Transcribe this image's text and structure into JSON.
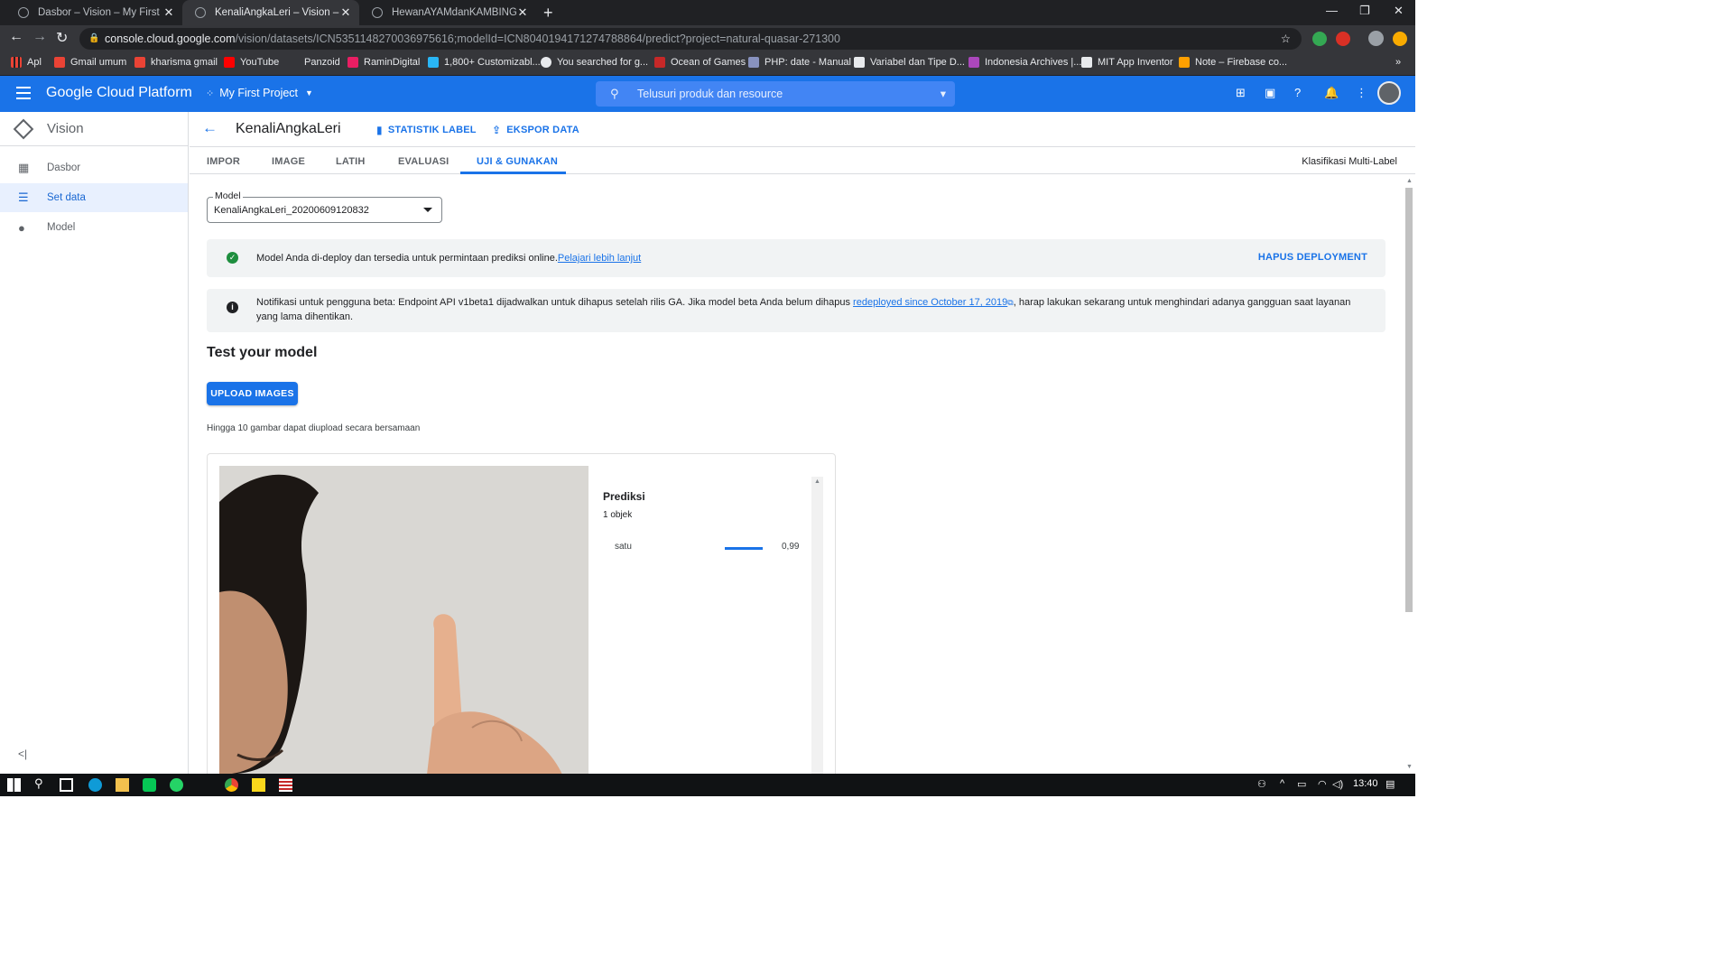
{
  "browser": {
    "tabs": [
      {
        "title": "Dasbor – Vision – My First Projec",
        "active": false
      },
      {
        "title": "KenaliAngkaLeri – Vision – My Fir",
        "active": true
      },
      {
        "title": "HewanAYAMdanKAMBING – Visi",
        "active": false
      }
    ],
    "url_host": "console.cloud.google.com",
    "url_path": "/vision/datasets/ICN5351148270036975616;modelId=ICN8040194171274788864/predict?project=natural-quasar-271300",
    "bookmarks": [
      "Apl",
      "Gmail umum",
      "kharisma gmail",
      "YouTube",
      "Panzoid",
      "RaminDigital",
      "1,800+ Customizabl...",
      "You searched for g...",
      "Ocean of Games",
      "PHP: date - Manual",
      "Variabel dan Tipe D...",
      "Indonesia Archives |...",
      "MIT App Inventor",
      "Note – Firebase co..."
    ]
  },
  "header": {
    "title": "Google Cloud Platform",
    "project": "My First Project",
    "search_placeholder": "Telusuri produk dan resource"
  },
  "sidenav": {
    "product": "Vision",
    "items": [
      {
        "label": "Dasbor",
        "icon": "dashboard-icon",
        "active": false
      },
      {
        "label": "Set data",
        "icon": "list-icon",
        "active": true
      },
      {
        "label": "Model",
        "icon": "lightbulb-icon",
        "active": false
      }
    ]
  },
  "main": {
    "dataset_title": "KenaliAngkaLeri",
    "actions": [
      "STATISTIK LABEL",
      "EKSPOR DATA"
    ],
    "tabs": [
      "IMPOR",
      "IMAGE",
      "LATIH",
      "EVALUASI",
      "UJI & GUNAKAN"
    ],
    "active_tab": "UJI & GUNAKAN",
    "mode": "Klasifikasi Multi-Label",
    "model_label": "Model",
    "model_value": "KenaliAngkaLeri_20200609120832",
    "banner_deploy": {
      "text": "Model Anda di-deploy dan tersedia untuk permintaan prediksi online.",
      "link": "Pelajari lebih lanjut",
      "action": "HAPUS DEPLOYMENT"
    },
    "banner_beta": {
      "text_before": "Notifikasi untuk pengguna beta: Endpoint API v1beta1 dijadwalkan untuk dihapus setelah rilis GA. Jika model beta Anda belum dihapus ",
      "link": "redeployed since October 17, 2019",
      "text_after": ", harap lakukan sekarang untuk menghindari adanya gangguan saat layanan yang lama dihentikan."
    },
    "test_title": "Test your model",
    "upload_button": "UPLOAD IMAGES",
    "upload_hint": "Hingga 10 gambar dapat diupload secara bersamaan",
    "prediction": {
      "title": "Prediksi",
      "count": "1 objek",
      "label": "satu",
      "score": "0,99",
      "score_fraction": 0.99
    }
  },
  "taskbar": {
    "time": "13:40"
  },
  "colors": {
    "brand": "#1a73e8",
    "success": "#1e8e3e"
  }
}
